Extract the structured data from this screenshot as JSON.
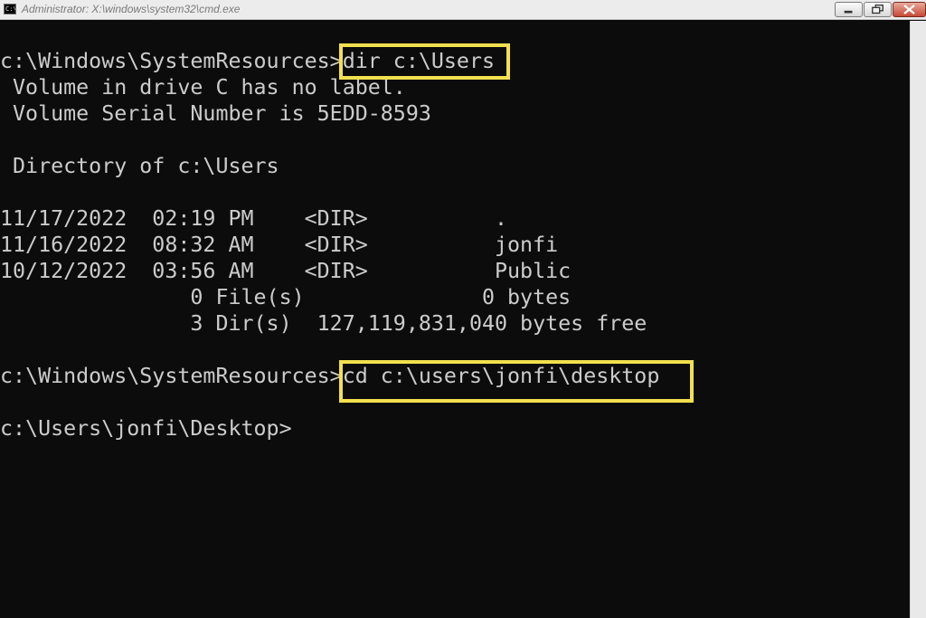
{
  "window": {
    "title": "Administrator: X:\\windows\\system32\\cmd.exe",
    "icon_text": "C:\\"
  },
  "console": {
    "lines": [
      "c:\\Windows\\SystemResources>dir c:\\Users",
      " Volume in drive C has no label.",
      " Volume Serial Number is 5EDD-8593",
      " Directory of c:\\Users",
      "11/17/2022  02:19 PM    <DIR>          .",
      "11/16/2022  08:32 AM    <DIR>          jonfi",
      "10/12/2022  03:56 AM    <DIR>          Public",
      "               0 File(s)              0 bytes",
      "               3 Dir(s)  127,119,831,040 bytes free",
      "c:\\Windows\\SystemResources>cd c:\\users\\jonfi\\desktop",
      "c:\\Users\\jonfi\\Desktop>"
    ]
  },
  "highlight_color": "#f2e04f"
}
